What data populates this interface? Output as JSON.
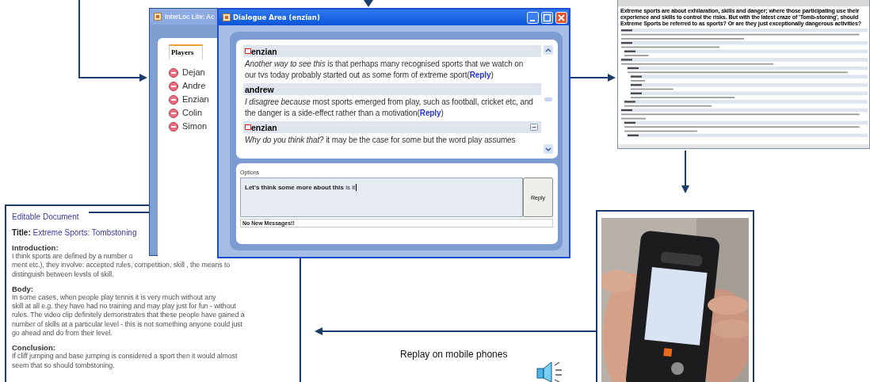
{
  "web_page": {
    "question": "Extreme sports are about exhilaration, skills and danger; where those participating use their experience and skills to control the risks. But with the latest craze of 'Tomb-stoning', should Extreme Sports be referred to as sports? Or are they just exceptionally dangerous activities?"
  },
  "interloc_window": {
    "title": "InterLoc Lite: Ac",
    "tabs": [
      {
        "label": "Players",
        "selected": true
      }
    ],
    "players": [
      "Dejan",
      "Andre",
      "Enzian",
      "Colin",
      "Simon"
    ]
  },
  "dialogue_window": {
    "title": "Dialogue Area (enzian)",
    "messages": [
      {
        "author": "enzian",
        "flagged": true,
        "collapsible": false,
        "text": "*Another way to see this* is that perhaps many recognised sports that we watch on our tvs today probably started out as some form of extreme sport",
        "reply": "(**Reply**)"
      },
      {
        "author": "andrew",
        "flagged": false,
        "collapsible": false,
        "text": "*I disagree because* most sports emerged from play, such as football, cricket etc, and the danger is a side-effect rather than a motivation",
        "reply": "(**Reply**)"
      },
      {
        "author": "enzian",
        "flagged": true,
        "collapsible": true,
        "text": "*Why do you think that?* it may be the case for some but the word play assumes"
      }
    ],
    "options_label": "Options",
    "input_value": "**Let's think some more about this**  is it",
    "reply_button": "Reply",
    "status": "No New Messages!!"
  },
  "document": {
    "heading": "Editable Document",
    "title_label": "Title:",
    "title_value": "Extreme Sports: Tombstoning",
    "sections": [
      {
        "heading": "Introduction:",
        "lines": [
          "I think sports are defined by a number o",
          "ment etc.), they involve: accepted rules, competition, skill , the means to",
          "distinguish between levsls of skill."
        ]
      },
      {
        "heading": "Body:",
        "lines": [
          "In some cases, when people play tennis  it is very much without any",
          "skill at all e.g. they have had no training and may play just for fun - without",
          "rules. The video clip definitely demonstrates that these people have gained a",
          "number of skills at a particular level - this is not something anyone could just",
          "go ahead and do from their level."
        ]
      },
      {
        "heading": "Conclusion:",
        "lines": [
          "If cliff jumping and base jumping is considered a sport then it would almost",
          "seem that so should tombstoning."
        ]
      }
    ]
  },
  "caption": "Replay on mobile phones"
}
